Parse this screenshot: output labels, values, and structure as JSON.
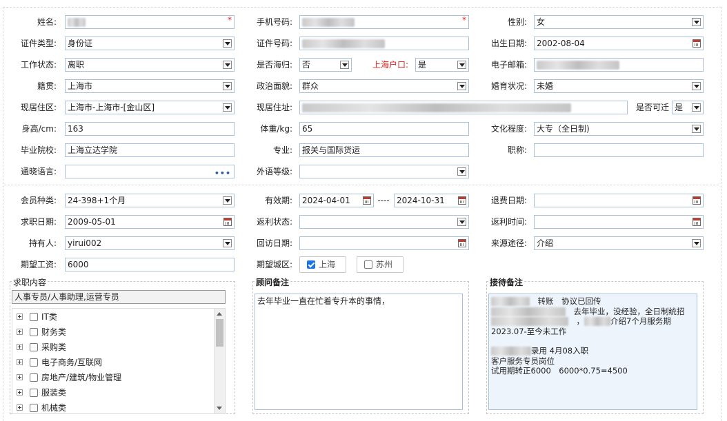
{
  "form": {
    "name": {
      "label": "姓名:"
    },
    "phone": {
      "label": "手机号码:"
    },
    "gender": {
      "label": "性别:",
      "value": "女"
    },
    "id_type": {
      "label": "证件类型:",
      "value": "身份证"
    },
    "id_number": {
      "label": "证件号码:"
    },
    "birth_date": {
      "label": "出生日期:",
      "value": "2002-08-04"
    },
    "work_status": {
      "label": "工作状态:",
      "value": "离职"
    },
    "overseas_returnee": {
      "label": "是否海归:",
      "value": "否"
    },
    "shanghai_hukou": {
      "label": "上海户口:",
      "value": "是"
    },
    "email": {
      "label": "电子邮箱:"
    },
    "native_place": {
      "label": "籍贯:",
      "value": "上海市"
    },
    "political_status": {
      "label": "政治面貌:",
      "value": "群众"
    },
    "marital_status": {
      "label": "婚育状况:",
      "value": "未婚"
    },
    "current_area": {
      "label": "现居住区:",
      "value": "上海市-上海市-[金山区]"
    },
    "current_address": {
      "label": "现居住址:"
    },
    "relocatable": {
      "label": "是否可迁",
      "value": "是"
    },
    "height": {
      "label": "身高/cm:",
      "value": "163"
    },
    "weight": {
      "label": "体重/kg:",
      "value": "65"
    },
    "education": {
      "label": "文化程度:",
      "value": "大专（全日制)"
    },
    "school": {
      "label": "毕业院校:",
      "value": "上海立达学院"
    },
    "major": {
      "label": "专业:",
      "value": "报关与国际货运"
    },
    "title": {
      "label": "职称:",
      "value": ""
    },
    "language": {
      "label": "通晓语言:",
      "value": ""
    },
    "foreign_level": {
      "label": "外语等级:",
      "value": ""
    },
    "member_type": {
      "label": "会员种类:",
      "value": "24-398+1个月"
    },
    "validity": {
      "label": "有效期:",
      "start": "2024-04-01",
      "sep": "----",
      "end": "2024-10-31"
    },
    "refund_date": {
      "label": "退费日期:",
      "value": ""
    },
    "job_seek_date": {
      "label": "求职日期:",
      "value": "2009-05-01"
    },
    "rebate_status": {
      "label": "返利状态:",
      "value": ""
    },
    "rebate_time": {
      "label": "返利时间:",
      "value": ""
    },
    "holder": {
      "label": "持有人:",
      "value": "yirui002"
    },
    "revisit_date": {
      "label": "回访日期:",
      "value": ""
    },
    "source": {
      "label": "来源途径:",
      "value": "介绍"
    },
    "expected_salary": {
      "label": "期望工资:",
      "value": "6000"
    },
    "expected_city": {
      "label": "期望城区:",
      "options": [
        {
          "label": "上海",
          "checked": true
        },
        {
          "label": "苏州",
          "checked": false
        }
      ]
    }
  },
  "job_content": {
    "title": "求职内容",
    "selected": "人事专员/人事助理,运营专员",
    "tree": [
      "IT类",
      "财务类",
      "采购类",
      "电子商务/互联网",
      "房地产/建筑/物业管理",
      "服装类",
      "机械类"
    ]
  },
  "advisor_notes": {
    "title": "顾问备注",
    "text": "去年毕业一直在忙着专升本的事情，"
  },
  "reception_notes": {
    "title": "接待备注",
    "lines": [
      "转账　协议已回传",
      "去年毕业，没经验，全日制统招",
      "介绍7个月服务期",
      "2023.07-至今未工作",
      "录用 4月08入职",
      "客户服务专员岗位",
      "试用期转正6000　6000*0.75=4500"
    ]
  },
  "colors": {
    "border": "#a9c1dc",
    "required": "#e02020",
    "accent": "#1a73e8"
  }
}
